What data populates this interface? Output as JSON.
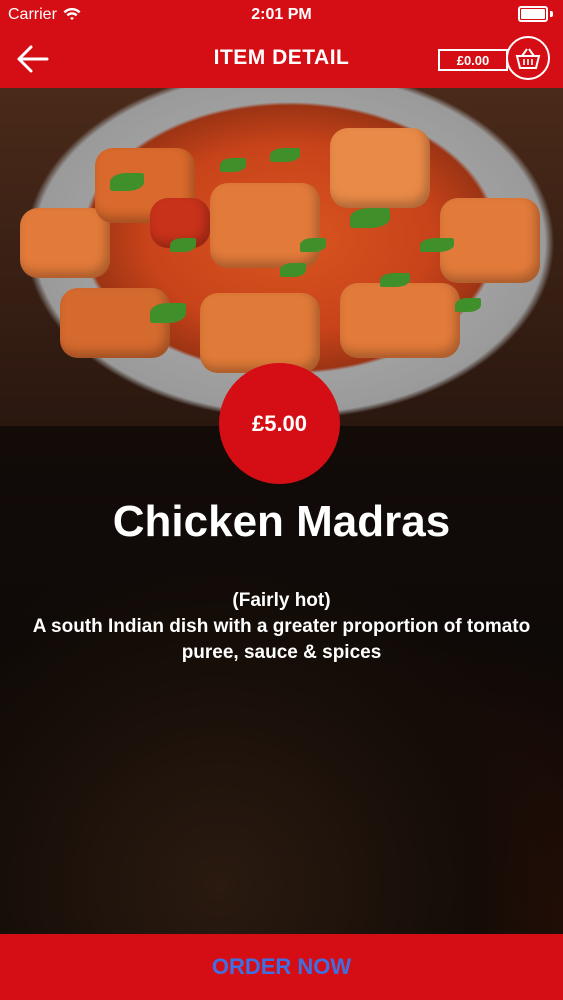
{
  "status_bar": {
    "carrier": "Carrier",
    "time": "2:01 PM"
  },
  "header": {
    "title": "ITEM DETAIL",
    "cart_total": "£0.00",
    "back_icon": "arrow-left-icon",
    "basket_icon": "basket-icon"
  },
  "item": {
    "price": "£5.00",
    "name": "Chicken Madras",
    "heat": "(Fairly hot)",
    "description": "A south Indian dish with a greater proportion of tomato puree, sauce & spices"
  },
  "actions": {
    "order_label": "ORDER NOW"
  },
  "colors": {
    "brand_red": "#d50e15",
    "order_text_blue": "#3f6fe0"
  }
}
